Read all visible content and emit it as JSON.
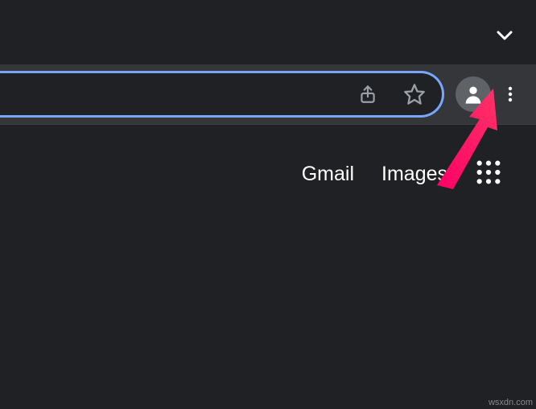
{
  "tabs": {
    "chevron_icon": "chevron-down"
  },
  "toolbar": {
    "share_icon": "share",
    "bookmark_icon": "star",
    "profile_icon": "person",
    "more_icon": "more-vertical"
  },
  "nav": {
    "gmail_label": "Gmail",
    "images_label": "Images",
    "apps_icon": "apps-grid"
  },
  "attribution": "wsxdn.com"
}
